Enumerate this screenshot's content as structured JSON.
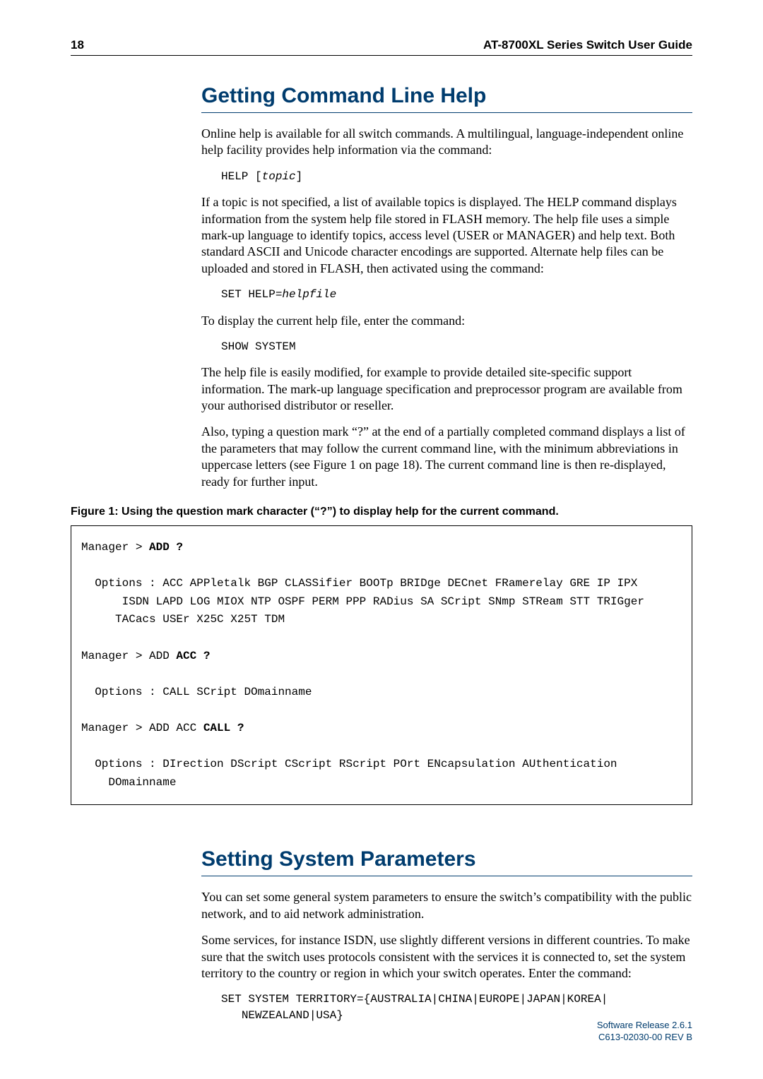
{
  "header": {
    "page_number": "18",
    "guide_title": "AT-8700XL Series Switch User Guide"
  },
  "section1": {
    "title": "Getting Command Line Help",
    "p1": "Online help is available for all switch commands. A multilingual, language-independent online help facility provides help information via the command:",
    "code1_cmd": "HELP [",
    "code1_param": "topic",
    "code1_close": "]",
    "p2": "If a topic is not specified, a list of available topics is displayed. The HELP command displays information from the system help file stored in FLASH memory. The help file uses a simple mark-up language to identify topics, access level (USER or MANAGER) and help text. Both standard ASCII and Unicode character encodings are supported. Alternate help files can be uploaded and stored in FLASH, then activated using the command:",
    "code2_cmd": "SET HELP=",
    "code2_param": "helpfile",
    "p3": "To display the current help file, enter the command:",
    "code3": "SHOW SYSTEM",
    "p4": "The help file is easily modified, for example to provide detailed site-specific support information. The mark-up language specification and preprocessor program are available from your authorised distributor or reseller.",
    "p5": "Also, typing a question mark “?” at the end of a partially completed command displays a list of the parameters that may follow the current command line, with the minimum abbreviations in uppercase letters (see Figure 1 on page 18). The current command line is then re-displayed, ready for further input."
  },
  "figure1": {
    "caption": "Figure 1: Using the question mark character (“?”) to display help for the current command.",
    "line1_pre": "Manager > ",
    "line1_bold": "ADD ?",
    "opts1": "  Options : ACC APPletalk BGP CLASSifier BOOTp BRIDge DECnet FRamerelay GRE IP IPX\n      ISDN LAPD LOG MIOX NTP OSPF PERM PPP RADius SA SCript SNmp STReam STT TRIGger\n     TACacs USEr X25C X25T TDM",
    "line2_pre": "Manager > ADD ",
    "line2_bold": "ACC ?",
    "opts2": "  Options : CALL SCript DOmainname",
    "line3_pre": "Manager > ADD ACC ",
    "line3_bold": "CALL ?",
    "opts3": "  Options : DIrection DScript CScript RScript POrt ENcapsulation AUthentication\n    DOmainname"
  },
  "section2": {
    "title": "Setting System Parameters",
    "p1": "You can set some general system parameters to ensure the switch’s compatibility with the public network, and to aid network administration.",
    "p2": "Some services, for instance ISDN, use slightly different versions in different countries. To make sure that the switch uses protocols consistent with the services it is connected to, set the system territory to the country or region in which your switch operates. Enter the command:",
    "code1": "SET SYSTEM TERRITORY={AUSTRALIA|CHINA|EUROPE|JAPAN|KOREA|\n   NEWZEALAND|USA}"
  },
  "footer": {
    "line1": "Software Release 2.6.1",
    "line2": "C613-02030-00 REV B"
  }
}
